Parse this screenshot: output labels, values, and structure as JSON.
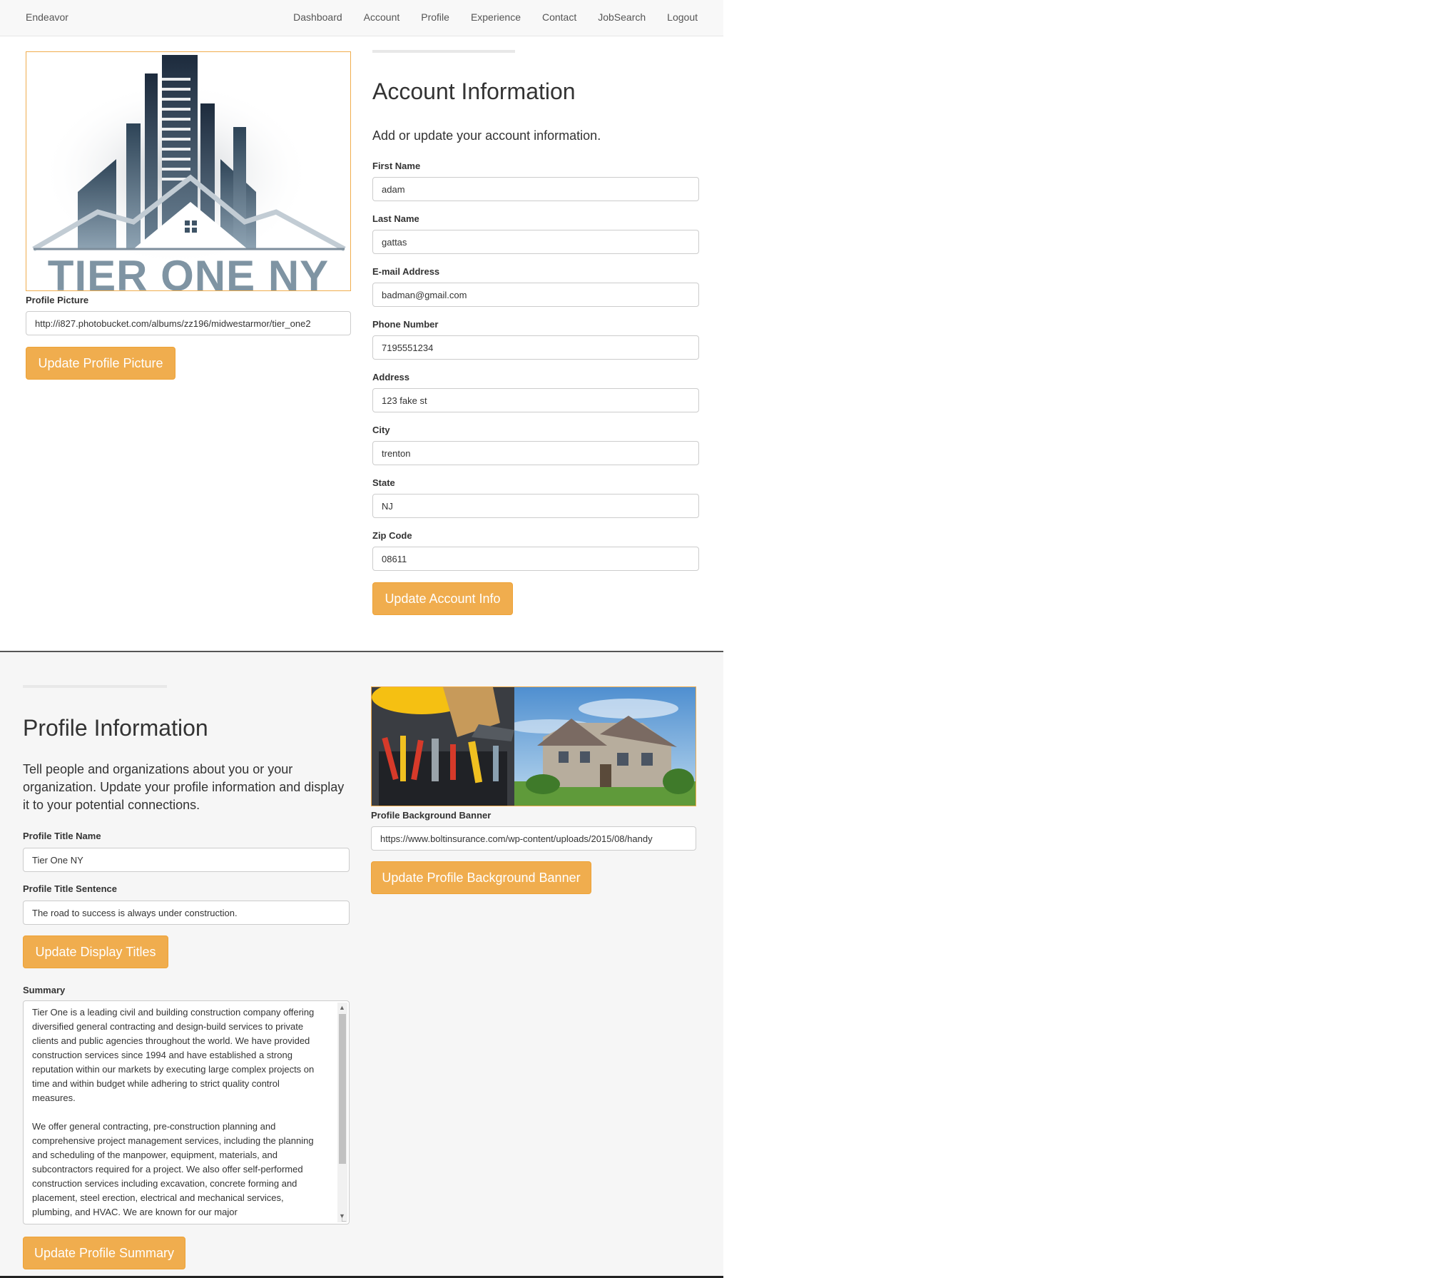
{
  "nav": {
    "brand": "Endeavor",
    "links": [
      "Dashboard",
      "Account",
      "Profile",
      "Experience",
      "Contact",
      "JobSearch",
      "Logout"
    ]
  },
  "profile_picture": {
    "logo_text": "TIER ONE NY",
    "label": "Profile Picture",
    "url_value": "http://i827.photobucket.com/albums/zz196/midwestarmor/tier_one2",
    "button_label": "Update Profile Picture"
  },
  "account": {
    "heading": "Account Information",
    "lead": "Add or update your account information.",
    "fields": [
      {
        "label": "First Name",
        "value": "adam"
      },
      {
        "label": "Last Name",
        "value": "gattas"
      },
      {
        "label": "E-mail Address",
        "value": "badman@gmail.com"
      },
      {
        "label": "Phone Number",
        "value": "7195551234"
      },
      {
        "label": "Address",
        "value": "123 fake st"
      },
      {
        "label": "City",
        "value": "trenton"
      },
      {
        "label": "State",
        "value": "NJ"
      },
      {
        "label": "Zip Code",
        "value": "08611"
      }
    ],
    "button_label": "Update Account Info"
  },
  "profile_info": {
    "heading": "Profile Information",
    "lead": "Tell people and organizations about you or your organization. Update your profile information and display it to your potential connections.",
    "title_name_label": "Profile Title Name",
    "title_name_value": "Tier One NY",
    "title_sentence_label": "Profile Title Sentence",
    "title_sentence_value": "The road to success is always under construction.",
    "titles_button_label": "Update Display Titles",
    "summary_label": "Summary",
    "summary_value": "Tier One is a leading civil and building construction company offering diversified general contracting and design-build services to private clients and public agencies throughout the world. We have provided construction services since 1994 and have established a strong reputation within our markets by executing large complex projects on time and within budget while adhering to strict quality control measures.\n\nWe offer general contracting, pre-construction planning and comprehensive project management services, including the planning and scheduling of the manpower, equipment, materials, and subcontractors required for a project. We also offer self-performed construction services including excavation, concrete forming and placement, steel erection, electrical and mechanical services, plumbing, and HVAC. We are known for our major",
    "summary_button_label": "Update Profile Summary"
  },
  "banner": {
    "label": "Profile Background Banner",
    "url_value": "https://www.boltinsurance.com/wp-content/uploads/2015/08/handy",
    "button_label": "Update Profile Background Banner"
  },
  "colors": {
    "accent": "#f0ad4e",
    "accent_border": "#eea236",
    "navbar_bg": "#f8f8f8",
    "bottom_section_bg": "#f6f6f6"
  }
}
